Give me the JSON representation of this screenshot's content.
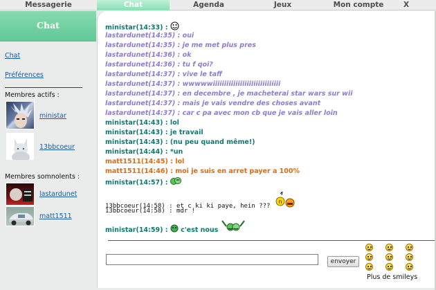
{
  "nav": {
    "tabs": [
      {
        "label": "Messagerie"
      },
      {
        "label": "Chat"
      },
      {
        "label": "Agenda"
      },
      {
        "label": "Jeux"
      },
      {
        "label": "Mon compte"
      },
      {
        "label": "X"
      }
    ],
    "active_index": 1,
    "active_color": "#87dfb1"
  },
  "sidebar": {
    "title": "Chat",
    "links": [
      {
        "label": "Chat"
      },
      {
        "label": "Préférences"
      }
    ],
    "active_members_label": "Membres actifs :",
    "active_members": [
      {
        "name": "ministar"
      },
      {
        "name": "13bbcoeur"
      }
    ],
    "sleeping_members_label": "Membres somnolents :",
    "sleeping_members": [
      {
        "name": "lastardunet"
      },
      {
        "name": "matt1511"
      }
    ]
  },
  "messages": [
    {
      "user": "ministar",
      "time": "14:33",
      "text": "",
      "style": "teal",
      "emoji": "smiley-face-icon"
    },
    {
      "user": "lastardunet",
      "time": "14:35",
      "text": "oui",
      "style": "purple"
    },
    {
      "user": "lastardunet",
      "time": "14:35",
      "text": "je me met plus pres",
      "style": "purple"
    },
    {
      "user": "lastardunet",
      "time": "14:36",
      "text": "ok",
      "style": "purple"
    },
    {
      "user": "lastardunet",
      "time": "14:36",
      "text": "tu f qoi?",
      "style": "purple"
    },
    {
      "user": "lastardunet",
      "time": "14:37",
      "text": "vive le taff",
      "style": "purple"
    },
    {
      "user": "lastardunet",
      "time": "14:37",
      "text": "wwwwwiiiiiiiiiiiiiiiiiiiiiiiiiiiiii",
      "style": "purple"
    },
    {
      "user": "lastardunet",
      "time": "14:37",
      "text": "en decembre , je macheterai star wars sur wii",
      "style": "purple"
    },
    {
      "user": "lastardunet",
      "time": "14:37",
      "text": "mais je vais vendre des choses avant",
      "style": "purple"
    },
    {
      "user": "lastardunet",
      "time": "14:37",
      "text": "car c pa avec mon cb que je vais aller loin",
      "style": "purple"
    },
    {
      "user": "ministar",
      "time": "14:43",
      "text": "lol",
      "style": "teal"
    },
    {
      "user": "ministar",
      "time": "14:43",
      "text": "je travail",
      "style": "teal"
    },
    {
      "user": "ministar",
      "time": "14:43",
      "text": "(nu peu quand même!)",
      "style": "teal"
    },
    {
      "user": "ministar",
      "time": "14:44",
      "text": "*un",
      "style": "teal"
    },
    {
      "user": "matt1511",
      "time": "14:45",
      "text": "lol",
      "style": "orange"
    },
    {
      "user": "matt1511",
      "time": "14:46",
      "text": "moi je suis en arret payer a 100%",
      "style": "orange"
    },
    {
      "user": "ministar",
      "time": "14:57",
      "text": "",
      "style": "teal",
      "emoji": "smiley-group-icon"
    },
    {
      "user": "13bbcoeur",
      "time": "14:58",
      "text": "et c ki ki paye, hein ???",
      "style": "plain",
      "emoji": "smiley-duo-icon"
    },
    {
      "user": "13bbcoeur",
      "time": "14:58",
      "text": "mdr !",
      "style": "plain"
    },
    {
      "user": "ministar",
      "time": "14:59",
      "text": "c'est nous",
      "style": "teal",
      "emoji": "smiley-wave-icon"
    }
  ],
  "composer": {
    "input_value": "",
    "send_label": "envoyer",
    "more_smileys_label": "Plus de smileys"
  },
  "colors": {
    "teal": "#0c7a6e",
    "purple": "#8d7bd4",
    "orange": "#e06a12",
    "link": "#1a5aa0"
  }
}
